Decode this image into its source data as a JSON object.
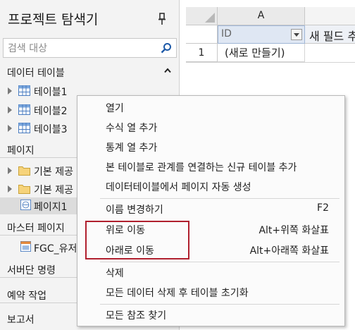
{
  "explorer": {
    "title": "프로젝트 탐색기",
    "search_placeholder": "검색 대상",
    "sections": {
      "data_tables": "데이터 테이블",
      "pages": "페이지",
      "master_pages": "마스터 페이지",
      "document_commands": "서버단 명령",
      "scheduled_tasks": "예약 작업",
      "reports": "보고서"
    },
    "tables": [
      "테이블1",
      "테이블2",
      "테이블3"
    ],
    "page_items": [
      "기본 제공",
      "기본 제공",
      "페이지1"
    ],
    "master_items": [
      "FGC_유저"
    ]
  },
  "grid": {
    "column_header": "A",
    "id_field": "ID",
    "new_field": "새 필드 추가",
    "row_number": "1",
    "new_row": "(새로 만들기)"
  },
  "context_menu": {
    "items": [
      {
        "label": "열기"
      },
      {
        "label": "수식 열 추가"
      },
      {
        "label": "통계 열 추가"
      },
      {
        "label": "본 테이블로 관계를 연결하는 신규 테이블 추가"
      },
      {
        "label": "데이터테이블에서 페이지 자동 생성"
      },
      {
        "label": "이름 변경하기",
        "shortcut": "F2"
      },
      {
        "label": "위로 이동",
        "shortcut": "Alt+위쪽 화살표"
      },
      {
        "label": "아래로 이동",
        "shortcut": "Alt+아래쪽 화살표"
      },
      {
        "label": "삭제"
      },
      {
        "label": "모든 데이터 삭제 후 테이블 초기화"
      },
      {
        "label": "모든 참조 찾기"
      }
    ]
  },
  "colors": {
    "highlight": "#b0202e",
    "panel_bg": "#f3f3f3",
    "selected_cell": "#dfe7f3"
  }
}
